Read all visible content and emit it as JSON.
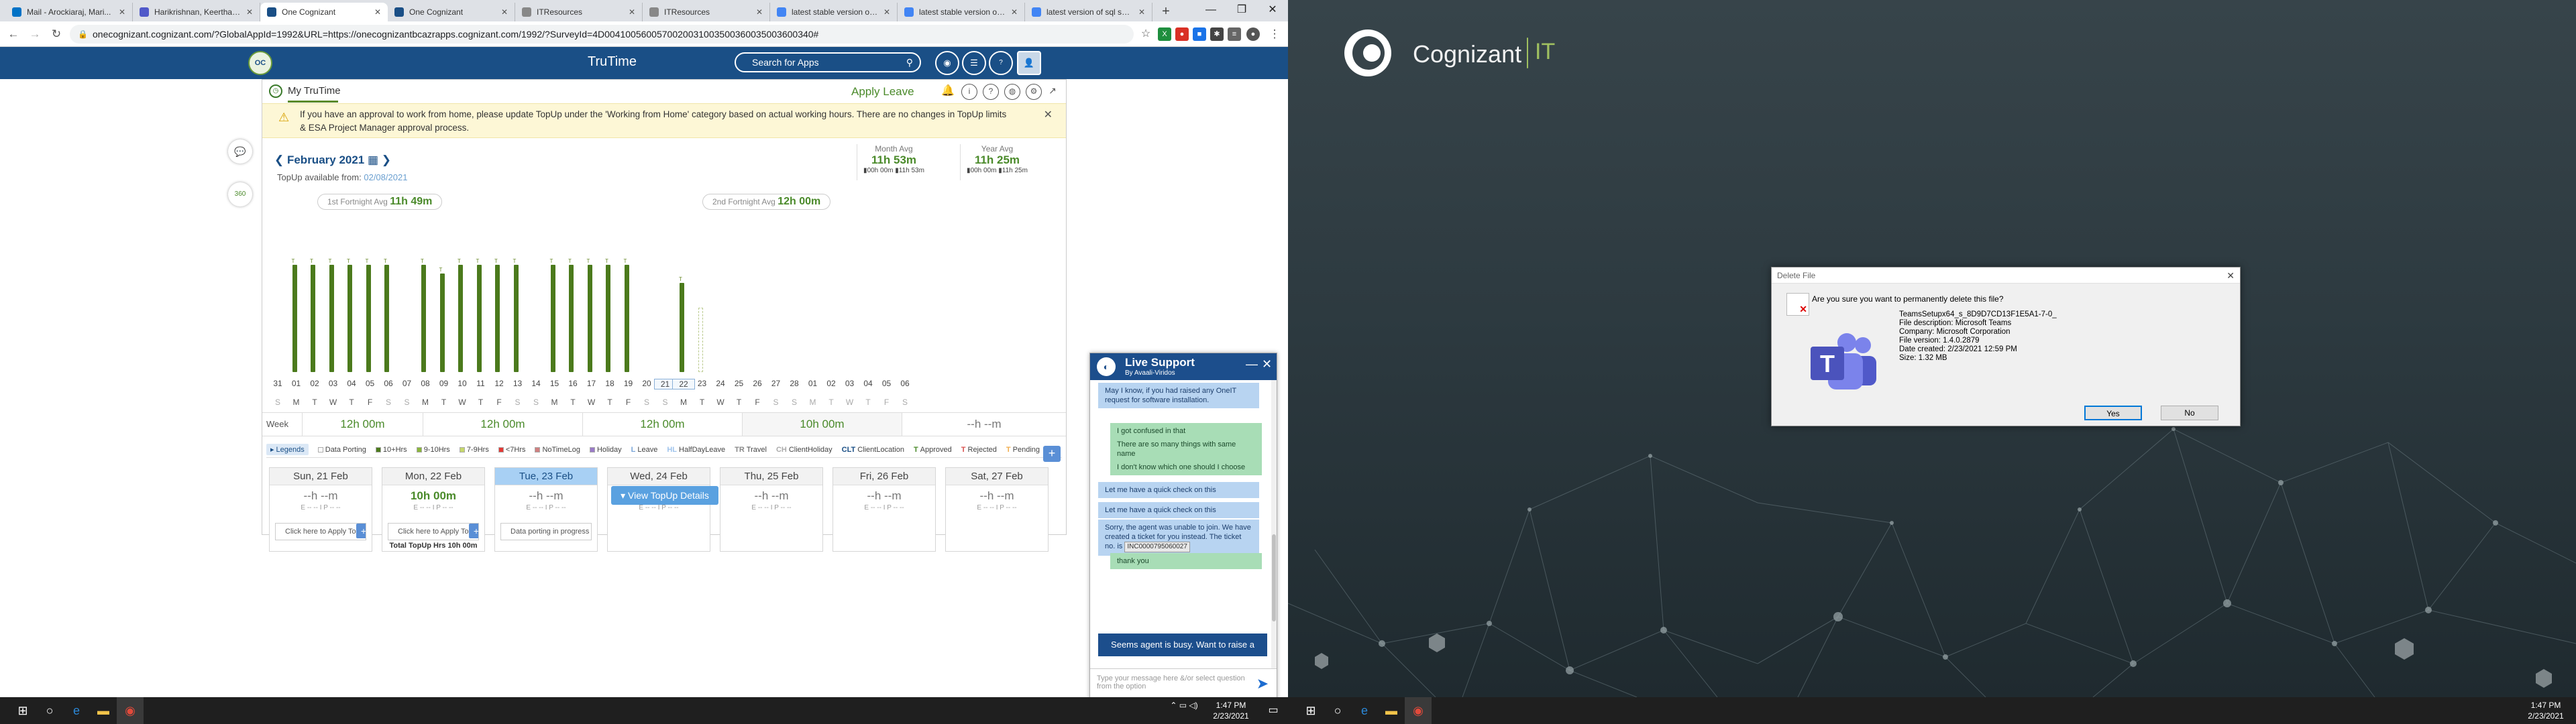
{
  "browser": {
    "tabs": [
      {
        "label": "Mail - Arockiaraj, Mari...",
        "icon": "outlook-icon",
        "color": "#0072c6",
        "active": false
      },
      {
        "label": "Harikrishnan, Keerthan...",
        "icon": "teams-icon",
        "color": "#5059c9",
        "active": false
      },
      {
        "label": "One Cognizant",
        "icon": "cognizant-icon",
        "color": "#1a4f86",
        "active": true
      },
      {
        "label": "One Cognizant",
        "icon": "cognizant-icon",
        "color": "#1a4f86",
        "active": false
      },
      {
        "label": "ITResources",
        "icon": "page-icon",
        "color": "#888888",
        "active": false
      },
      {
        "label": "ITResources",
        "icon": "page-icon",
        "color": "#888888",
        "active": false
      },
      {
        "label": "latest stable version of...",
        "icon": "google-icon",
        "color": "#4285f4",
        "active": false
      },
      {
        "label": "latest stable version of...",
        "icon": "google-icon",
        "color": "#4285f4",
        "active": false
      },
      {
        "label": "latest version of sql ser...",
        "icon": "google-icon",
        "color": "#4285f4",
        "active": false
      }
    ],
    "new_tab": "+",
    "url": "onecognizant.cognizant.com/?GlobalAppId=1992&URL=https://onecognizantbcazrapps.cognizant.com/1992/?SurveyId=4D0041005600570020031003500360035003600340#",
    "window_controls": [
      "—",
      "❐",
      "✕"
    ]
  },
  "app": {
    "title": "TruTime",
    "search_placeholder": "Search for Apps"
  },
  "trutime": {
    "heading": "My TruTime",
    "apply_leave": "Apply Leave",
    "alert": "If you have an approval to work from home, please update TopUp under the 'Working from Home' category based on actual working hours. There are no changes in TopUp limits & ESA Project Manager approval process.",
    "month": "February 2021",
    "topup_available_label": "TopUp available from:",
    "topup_available_date": "02/08/2021",
    "month_avg": {
      "label": "Month Avg",
      "value": "11h 53m",
      "sub1": "00h 00m",
      "sub2": "11h 53m"
    },
    "year_avg": {
      "label": "Year Avg",
      "value": "11h 25m",
      "sub1": "00h 00m",
      "sub2": "11h 25m"
    },
    "fortnight1": {
      "label": "1st Fortnight Avg",
      "value": "11h 49m"
    },
    "fortnight2": {
      "label": "2nd Fortnight Avg",
      "value": "12h 00m"
    },
    "week_avg_label": "Week Avg",
    "week_avgs": [
      "12h 00m",
      "12h 00m",
      "12h 00m",
      "10h 00m",
      "--h --m"
    ],
    "legend_title": "Legends",
    "legends": [
      {
        "label": "Data Porting",
        "color": "#ffffff"
      },
      {
        "label": "10+Hrs",
        "color": "#4b7a1c"
      },
      {
        "label": "9-10Hrs",
        "color": "#8ab63a"
      },
      {
        "label": "7-9Hrs",
        "color": "#c6d86a"
      },
      {
        "label": "<7Hrs",
        "color": "#e53935"
      },
      {
        "label": "NoTimeLog",
        "color": "#d08080"
      },
      {
        "label": "Holiday",
        "color": "#9a7ac8"
      },
      {
        "label": "Leave",
        "color": "#7aa6d8"
      },
      {
        "label": "HalfDayLeave",
        "color": "#a0c4ec"
      },
      {
        "label": "Travel",
        "color": "#888888"
      },
      {
        "label": "ClientHoliday",
        "color": "#aaaaaa"
      },
      {
        "label": "ClientLocation",
        "color": "#1a4f86"
      },
      {
        "label": "Approved",
        "color": "#4a8a2a"
      },
      {
        "label": "Rejected",
        "color": "#d9534f"
      },
      {
        "label": "Pending",
        "color": "#f0ad4e"
      }
    ],
    "legend_codes": [
      "",
      "",
      "",
      "",
      "",
      "",
      "",
      "L",
      "HL",
      "TR",
      "CH",
      "CLT",
      "T",
      "T",
      "T"
    ],
    "days": [
      {
        "d": "31",
        "w": "S",
        "h": 0
      },
      {
        "d": "01",
        "w": "M",
        "h": 12
      },
      {
        "d": "02",
        "w": "T",
        "h": 12
      },
      {
        "d": "03",
        "w": "W",
        "h": 12
      },
      {
        "d": "04",
        "w": "T",
        "h": 12
      },
      {
        "d": "05",
        "w": "F",
        "h": 12
      },
      {
        "d": "06",
        "w": "S",
        "h": 12
      },
      {
        "d": "07",
        "w": "S",
        "h": 0
      },
      {
        "d": "08",
        "w": "M",
        "h": 12
      },
      {
        "d": "09",
        "w": "T",
        "h": 11
      },
      {
        "d": "10",
        "w": "W",
        "h": 12
      },
      {
        "d": "11",
        "w": "T",
        "h": 12
      },
      {
        "d": "12",
        "w": "F",
        "h": 12
      },
      {
        "d": "13",
        "w": "S",
        "h": 12
      },
      {
        "d": "14",
        "w": "S",
        "h": 0
      },
      {
        "d": "15",
        "w": "M",
        "h": 12
      },
      {
        "d": "16",
        "w": "T",
        "h": 12
      },
      {
        "d": "17",
        "w": "W",
        "h": 12
      },
      {
        "d": "18",
        "w": "T",
        "h": 12
      },
      {
        "d": "19",
        "w": "F",
        "h": 12
      },
      {
        "d": "20",
        "w": "S",
        "h": 0
      },
      {
        "d": "21",
        "w": "S",
        "h": 0
      },
      {
        "d": "22",
        "w": "M",
        "h": 10
      },
      {
        "d": "23",
        "w": "T",
        "h": -1
      },
      {
        "d": "24",
        "w": "W",
        "h": 0
      },
      {
        "d": "25",
        "w": "T",
        "h": 0
      },
      {
        "d": "26",
        "w": "F",
        "h": 0
      },
      {
        "d": "27",
        "w": "S",
        "h": 0
      },
      {
        "d": "28",
        "w": "S",
        "h": 0
      },
      {
        "d": "01",
        "w": "M",
        "h": 0
      },
      {
        "d": "02",
        "w": "T",
        "h": 0
      },
      {
        "d": "03",
        "w": "W",
        "h": 0
      },
      {
        "d": "04",
        "w": "T",
        "h": 0
      },
      {
        "d": "05",
        "w": "F",
        "h": 0
      },
      {
        "d": "06",
        "w": "S",
        "h": 0
      }
    ],
    "day_cards": [
      {
        "title": "Sun, 21 Feb",
        "hours": "--h --m",
        "sub": "E -- -- I P -- --",
        "topup": "Click here to Apply TopUp",
        "total": "",
        "today": false
      },
      {
        "title": "Mon, 22 Feb",
        "hours": "10h 00m",
        "sub": "E -- -- I P -- --",
        "topup": "Click here to Apply TopUp",
        "total": "Total TopUp Hrs 10h 00m",
        "today": false
      },
      {
        "title": "Tue, 23 Feb",
        "hours": "--h --m",
        "sub": "E -- -- I P -- --",
        "topup": "Data porting in progress",
        "total": "",
        "today": true
      },
      {
        "title": "Wed, 24 Feb",
        "hours": "--h --m",
        "sub": "E -- -- I P -- --",
        "topup": "",
        "total": "",
        "today": false
      },
      {
        "title": "Thu, 25 Feb",
        "hours": "--h --m",
        "sub": "E -- -- I P -- --",
        "topup": "",
        "total": "",
        "today": false
      },
      {
        "title": "Fri, 26 Feb",
        "hours": "--h --m",
        "sub": "E -- -- I P -- --",
        "topup": "",
        "total": "",
        "today": false
      },
      {
        "title": "Sat, 27 Feb",
        "hours": "--h --m",
        "sub": "E -- -- I P -- --",
        "topup": "",
        "total": "",
        "today": false
      }
    ],
    "view_topup": "View TopUp Details"
  },
  "chat": {
    "title": "Live Support",
    "subtitle": "By Avaali-Viridos",
    "messages": [
      {
        "from": "agent",
        "text": "May I know, if you had raised any OneIT request for software installation."
      },
      {
        "from": "user",
        "text": "I got confused in that"
      },
      {
        "from": "user",
        "text": "There are so many things with same name"
      },
      {
        "from": "user",
        "text": "I don't know which one should I choose"
      },
      {
        "from": "agent",
        "text": "Let me have a quick check on this"
      },
      {
        "from": "agent",
        "text": "Let me have a quick check on this"
      },
      {
        "from": "agent",
        "text": "Sorry, the agent was unable to join. We have created a ticket for you instead. The ticket no. is"
      },
      {
        "from": "user",
        "text": "thank you"
      }
    ],
    "ticket": "INC0000795060027",
    "raise_ticket": "Seems agent is busy. Want to raise a ticket?",
    "input_placeholder": "Type your message here &/or select question from the option"
  },
  "taskbar_left": {
    "time": "1:47 PM",
    "date": "2/23/2021"
  },
  "taskbar_right": {
    "time": "1:47 PM",
    "date": "2/23/2021"
  },
  "desktop": {
    "brand": "Cognizant",
    "brand_suffix": "IT",
    "dialog": {
      "title": "Delete File",
      "question": "Are you sure you want to permanently delete this file?",
      "file_name": "TeamsSetupx64_s_8D9D7CD13F1E5A1-7-0_",
      "description": "File description: Microsoft Teams",
      "company": "Company: Microsoft Corporation",
      "version": "File version: 1.4.0.2879",
      "created": "Date created: 2/23/2021 12:59 PM",
      "size": "Size: 1.32 MB",
      "yes": "Yes",
      "no": "No"
    }
  }
}
